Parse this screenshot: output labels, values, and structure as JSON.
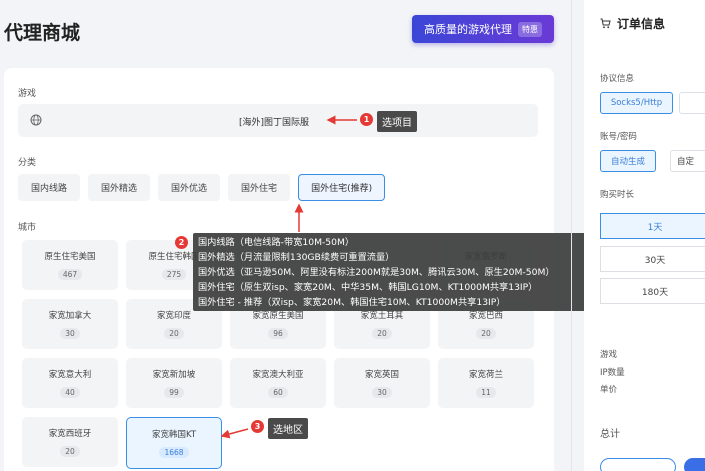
{
  "page": {
    "title": "代理商城",
    "promo_label": "高质量的游戏代理",
    "promo_tag": "特惠"
  },
  "game": {
    "label": "游戏",
    "value": "[海外]图丁国际服"
  },
  "category": {
    "label": "分类",
    "items": [
      "国内线路",
      "国外精选",
      "国外优选",
      "国外住宅",
      "国外住宅(推荐)"
    ],
    "selected_index": 4
  },
  "city": {
    "label": "城市",
    "items": [
      {
        "name": "原生住宅美国",
        "count": "467"
      },
      {
        "name": "原生住宅韩国",
        "count": "275"
      },
      {
        "name": "",
        "count": ""
      },
      {
        "name": "",
        "count": ""
      },
      {
        "name": "家宽俄罗斯",
        "count": ""
      },
      {
        "name": "家宽加拿大",
        "count": "30"
      },
      {
        "name": "家宽印度",
        "count": "20"
      },
      {
        "name": "家宽原生美国",
        "count": "96"
      },
      {
        "name": "家宽土耳其",
        "count": "20"
      },
      {
        "name": "家宽巴西",
        "count": "20"
      },
      {
        "name": "家宽意大利",
        "count": "40"
      },
      {
        "name": "家宽新加坡",
        "count": "99"
      },
      {
        "name": "家宽澳大利亚",
        "count": "60"
      },
      {
        "name": "家宽英国",
        "count": "30"
      },
      {
        "name": "家宽荷兰",
        "count": "11"
      },
      {
        "name": "家宽西班牙",
        "count": "20"
      },
      {
        "name": "家宽韩国KT",
        "count": "1668"
      }
    ],
    "selected_index": 16
  },
  "tooltip": {
    "lines": [
      "国内线路（电信线路-带宽10M-50M）",
      "国外精选（月流量限制130GB续费可重置流量）",
      "国外优选（亚马逊50M、阿里没有标注200M就是30M、腾讯云30M、原生20M-50M）",
      "国外住宅（原生双isp、家宽20M、中华35M、韩国LG10M、KT1000M共享13IP）",
      "国外住宅 - 推荐（双isp、家宽20M、韩国住宅10M、KT1000M共享13IP）"
    ]
  },
  "annotations": [
    {
      "number": "1",
      "text": "选项目"
    },
    {
      "number": "2",
      "text": ""
    },
    {
      "number": "3",
      "text": "选地区"
    }
  ],
  "sidebar": {
    "title": "订单信息",
    "protocol_label": "协议信息",
    "protocol_options": [
      "Socks5/Http",
      ""
    ],
    "account_label": "账号/密码",
    "account_options": [
      "自动生成",
      "自定"
    ],
    "duration_label": "购买时长",
    "durations": [
      "1天",
      "30天",
      "180天"
    ],
    "summary": [
      "游戏",
      "IP数量",
      "单价"
    ],
    "total_label": "总计"
  },
  "colors": {
    "accent": "#3a8ee6",
    "promo_start": "#3b46d6",
    "promo_end": "#6a3ad6",
    "annotation_red": "#e53935"
  }
}
